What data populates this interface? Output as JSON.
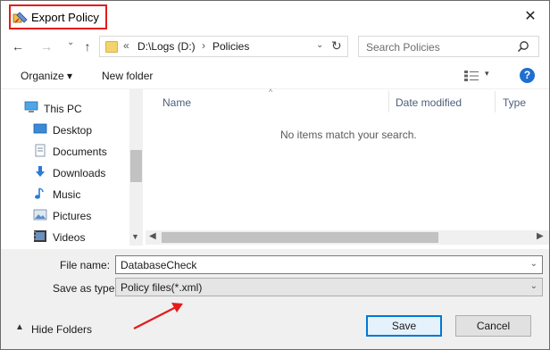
{
  "window": {
    "title": "Export Policy",
    "close_glyph": "✕"
  },
  "nav": {
    "back_glyph": "←",
    "forward_glyph": "→",
    "recent_glyph": "⌄",
    "up_glyph": "↑",
    "address": {
      "overflow": "«",
      "crumbs": [
        "D:\\Logs (D:)",
        "Policies"
      ],
      "sep": "›",
      "dropdown_glyph": "⌄",
      "refresh_glyph": "↻"
    },
    "search": {
      "placeholder": "Search Policies"
    }
  },
  "toolbar": {
    "organize_label": "Organize ▾",
    "new_folder_label": "New folder",
    "view_chevron": "▾",
    "help_glyph": "?"
  },
  "sidebar": {
    "items": [
      {
        "label": "This PC",
        "icon": "computer-icon"
      },
      {
        "label": "Desktop",
        "icon": "desktop-icon"
      },
      {
        "label": "Documents",
        "icon": "documents-icon"
      },
      {
        "label": "Downloads",
        "icon": "downloads-icon"
      },
      {
        "label": "Music",
        "icon": "music-icon"
      },
      {
        "label": "Pictures",
        "icon": "pictures-icon"
      },
      {
        "label": "Videos",
        "icon": "videos-icon"
      }
    ]
  },
  "files": {
    "columns": [
      "Name",
      "Date modified",
      "Type"
    ],
    "empty_message": "No items match your search."
  },
  "form": {
    "file_name_label": "File name:",
    "file_name_value": "DatabaseCheck",
    "save_type_label": "Save as type:",
    "save_type_value": "Policy files(*.xml)"
  },
  "footer": {
    "hide_folders_label": "Hide Folders",
    "save_label": "Save",
    "cancel_label": "Cancel"
  },
  "colors": {
    "annotation_red": "#e31b1b",
    "accent_blue": "#0078d7"
  }
}
